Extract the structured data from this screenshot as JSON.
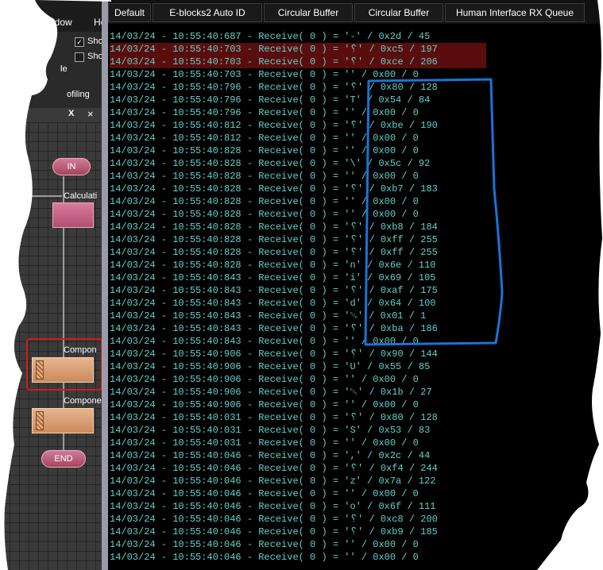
{
  "left_panel": {
    "menu": {
      "window": "Window",
      "help": "He"
    },
    "options": [
      {
        "label": "Sho",
        "checked": true
      },
      {
        "label": "Sho",
        "checked": false
      },
      {
        "label": "le",
        "checked": false
      }
    ],
    "profiling": "ofiling",
    "tab": {
      "label": "X",
      "close": "×"
    },
    "flowchart": {
      "start": "IN",
      "calculation": "Calculati",
      "component1": "Compon",
      "component2": "Compone",
      "end": "END"
    }
  },
  "tabs": [
    "Default",
    "E-blocks2 Auto ID",
    "Circular Buffer",
    "Circular Buffer",
    "Human Interface RX Queue"
  ],
  "log_rows": [
    "14/03/24 - 10:55:40:687 - Receive( 0 ) = '-' / 0x2d / 45",
    "14/03/24 - 10:55:40:703 - Receive( 0 ) = '␦' / 0xc5 / 197",
    "14/03/24 - 10:55:40:703 - Receive( 0 ) = '␦' / 0xce / 206",
    "14/03/24 - 10:55:40:703 - Receive( 0 ) = '' / 0x00 / 0",
    "14/03/24 - 10:55:40:796 - Receive( 0 ) = '␦' / 0x80 / 128",
    "14/03/24 - 10:55:40:796 - Receive( 0 ) = 'T' / 0x54 / 84",
    "14/03/24 - 10:55:40:796 - Receive( 0 ) = '' / 0x00 / 0",
    "14/03/24 - 10:55:40:812 - Receive( 0 ) = '␦' / 0xbe / 190",
    "14/03/24 - 10:55:40:812 - Receive( 0 ) = '' / 0x00 / 0",
    "14/03/24 - 10:55:40:828 - Receive( 0 ) = '' / 0x00 / 0",
    "14/03/24 - 10:55:40:828 - Receive( 0 ) = '\\' / 0x5c / 92",
    "14/03/24 - 10:55:40:828 - Receive( 0 ) = '' / 0x00 / 0",
    "14/03/24 - 10:55:40:828 - Receive( 0 ) = '␦' / 0xb7 / 183",
    "14/03/24 - 10:55:40:828 - Receive( 0 ) = '' / 0x00 / 0",
    "14/03/24 - 10:55:40:828 - Receive( 0 ) = '' / 0x00 / 0",
    "14/03/24 - 10:55:40:828 - Receive( 0 ) = '␦' / 0xb8 / 184",
    "14/03/24 - 10:55:40:828 - Receive( 0 ) = '␦' / 0xff / 255",
    "14/03/24 - 10:55:40:828 - Receive( 0 ) = '␦' / 0xff / 255",
    "14/03/24 - 10:55:40:828 - Receive( 0 ) = 'n' / 0x6e / 110",
    "14/03/24 - 10:55:40:843 - Receive( 0 ) = 'i' / 0x69 / 105",
    "14/03/24 - 10:55:40:843 - Receive( 0 ) = '␦' / 0xaf / 175",
    "14/03/24 - 10:55:40:843 - Receive( 0 ) = 'd' / 0x64 / 100",
    "14/03/24 - 10:55:40:843 - Receive( 0 ) = '␁' / 0x01 / 1",
    "14/03/24 - 10:55:40:843 - Receive( 0 ) = '␦' / 0xba / 186",
    "14/03/24 - 10:55:40:843 - Receive( 0 ) = '' / 0x00 / 0",
    "14/03/24 - 10:55:40:906 - Receive( 0 ) = '␦' / 0x90 / 144",
    "14/03/24 - 10:55:40:906 - Receive( 0 ) = 'U' / 0x55 / 85",
    "14/03/24 - 10:55:40:906 - Receive( 0 ) = '' / 0x00 / 0",
    "14/03/24 - 10:55:40:906 - Receive( 0 ) = '␛' / 0x1b / 27",
    "14/03/24 - 10:55:40:906 - Receive( 0 ) = '' / 0x00 / 0",
    "14/03/24 - 10:55:40:031 - Receive( 0 ) = '␦' / 0x80 / 128",
    "14/03/24 - 10:55:40:031 - Receive( 0 ) = 'S' / 0x53 / 83",
    "14/03/24 - 10:55:40:031 - Receive( 0 ) = '' / 0x00 / 0",
    "14/03/24 - 10:55:40:046 - Receive( 0 ) = ',' / 0x2c / 44",
    "14/03/24 - 10:55:40:046 - Receive( 0 ) = '␦' / 0xf4 / 244",
    "14/03/24 - 10:55:40:046 - Receive( 0 ) = 'z' / 0x7a / 122",
    "14/03/24 - 10:55:40:046 - Receive( 0 ) = '' / 0x00 / 0",
    "14/03/24 - 10:55:40:046 - Receive( 0 ) = 'o' / 0x6f / 111",
    "14/03/24 - 10:55:40:046 - Receive( 0 ) = '␦' / 0xc8 / 200",
    "14/03/24 - 10:55:40:046 - Receive( 0 ) = '␦' / 0xb9 / 185",
    "14/03/24 - 10:55:40:046 - Receive( 0 ) = '' / 0x00 / 0",
    "14/03/24 - 10:55:40:046 - Receive( 0 ) = '' / 0x00 / 0"
  ],
  "highlighted_rows": [
    1,
    2
  ],
  "colors": {
    "log_text": "#64d0c8",
    "error_row_bg": "#5a0d0d",
    "annotation": "#1a74d6",
    "selection": "#d61a1a"
  }
}
